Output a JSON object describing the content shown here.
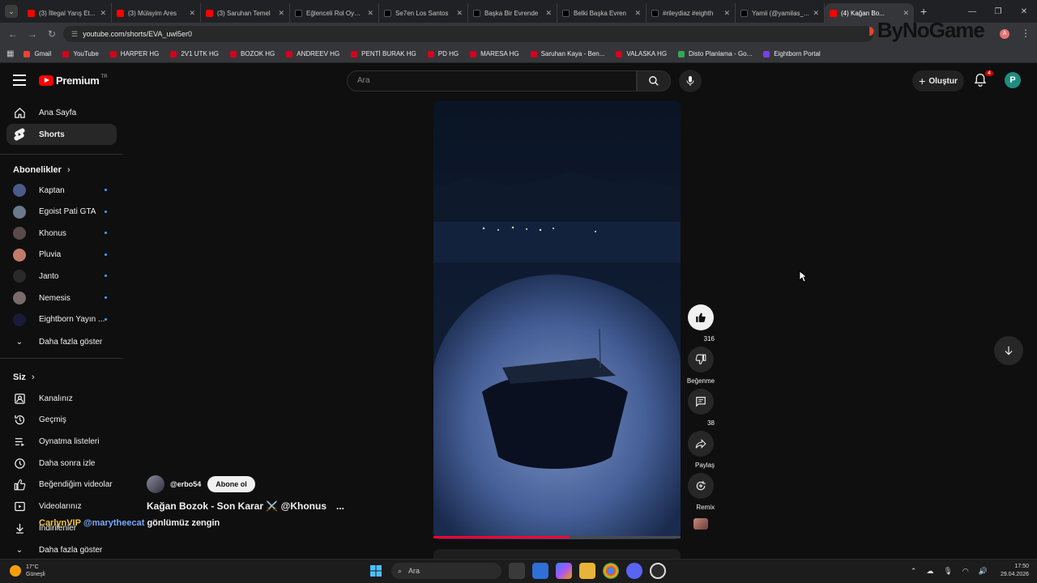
{
  "browser": {
    "tabs": [
      {
        "title": "(3) İllegal Yarış Et...",
        "kind": "yt"
      },
      {
        "title": "(3) Mülayim Ares",
        "kind": "yt"
      },
      {
        "title": "(3) Saruhan Temel",
        "kind": "yt"
      },
      {
        "title": "Eğlenceli Rol Oyun...",
        "kind": "tt"
      },
      {
        "title": "Se7en Los Santos",
        "kind": "tt"
      },
      {
        "title": "Başka Bir Evrende",
        "kind": "tt"
      },
      {
        "title": "Belki Başka Evren",
        "kind": "tt"
      },
      {
        "title": "#rileydiaz #eighth",
        "kind": "tt"
      },
      {
        "title": "Yamii (@yamilas_...",
        "kind": "tt"
      },
      {
        "title": "(4) Kağan Bo...",
        "kind": "yt",
        "active": true
      }
    ],
    "url": "youtube.com/shorts/EVA_uwl5er0",
    "watermark": "ByNoGame",
    "profile_initial": "A",
    "bookmarks": [
      {
        "label": "Gmail",
        "icon": "g"
      },
      {
        "label": "YouTube",
        "icon": "red"
      },
      {
        "label": "HARPER HG",
        "icon": "red"
      },
      {
        "label": "2V1 UTK HG",
        "icon": "red"
      },
      {
        "label": "BOZOK HG",
        "icon": "red"
      },
      {
        "label": "ANDREEV HG",
        "icon": "red"
      },
      {
        "label": "PENTİ BURAK HG",
        "icon": "red"
      },
      {
        "label": "PD HG",
        "icon": "red"
      },
      {
        "label": "MARESA HG",
        "icon": "red"
      },
      {
        "label": "Saruhan Kaya - Ben...",
        "icon": "red"
      },
      {
        "label": "VALASKA HG",
        "icon": "red"
      },
      {
        "label": "Disto Planlama - Go...",
        "icon": "green"
      },
      {
        "label": "Eightborn Portal",
        "icon": "purple"
      }
    ]
  },
  "header": {
    "logo_text": "Premium",
    "country": "TR",
    "search_placeholder": "Ara",
    "create_label": "Oluştur",
    "notif_count": "4"
  },
  "sidebar": {
    "main": [
      {
        "label": "Ana Sayfa",
        "icon": "home-icon"
      },
      {
        "label": "Shorts",
        "icon": "shorts-icon",
        "active": true
      }
    ],
    "subs_heading": "Abonelikler",
    "subs": [
      {
        "label": "Kaptan",
        "color": "#4a5a8a"
      },
      {
        "label": "Egoist Pati GTA",
        "color": "#6b7a8a"
      },
      {
        "label": "Khonus",
        "color": "#5a4a4a"
      },
      {
        "label": "Pluvia",
        "color": "#c47a6a"
      },
      {
        "label": "Janto",
        "color": "#2a2a2a"
      },
      {
        "label": "Nemesis",
        "color": "#7a6a6a"
      },
      {
        "label": "Eightborn Yayın ...",
        "color": "#1a1a3a"
      }
    ],
    "show_more": "Daha fazla göster",
    "you_heading": "Siz",
    "you": [
      {
        "label": "Kanalınız",
        "icon": "channel-icon"
      },
      {
        "label": "Geçmiş",
        "icon": "history-icon"
      },
      {
        "label": "Oynatma listeleri",
        "icon": "playlist-icon"
      },
      {
        "label": "Daha sonra izle",
        "icon": "clock-icon"
      },
      {
        "label": "Beğendiğim videolar",
        "icon": "like-icon"
      },
      {
        "label": "Videolarınız",
        "icon": "video-icon"
      },
      {
        "label": "İndirilenler",
        "icon": "download-icon"
      }
    ],
    "show_more_2": "Daha fazla göster"
  },
  "short": {
    "channel": "@erbo54",
    "subscribe": "Abone ol",
    "title": "Kağan Bozok - Son Karar ⚔️  @Khonus",
    "more": "...",
    "desc_user1": "CarlynVIP",
    "desc_user2": "@marytheecat",
    "desc_text": "gönlümüz zengin",
    "progress": 0.55,
    "likes": "316",
    "dislike_label": "Beğenme",
    "comments": "38",
    "share_label": "Paylaş",
    "remix_label": "Remix"
  },
  "taskbar": {
    "temp": "17°C",
    "weather": "Güneşli",
    "search": "Ara",
    "time": "17:50",
    "date": "29.04.2026"
  }
}
